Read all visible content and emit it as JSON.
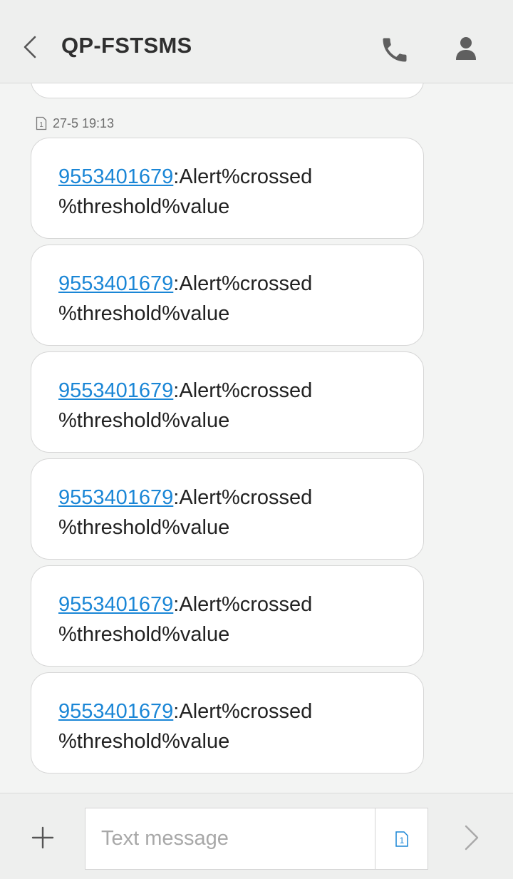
{
  "header": {
    "title": "QP-FSTSMS",
    "back_icon": "chevron-left-icon",
    "call_icon": "phone-icon",
    "contact_icon": "person-icon"
  },
  "thread": {
    "timestamp": "27-5 19:13",
    "sim_badge": "1",
    "messages": [
      {
        "sender_number": "9553401679",
        "line1": ":Alert%crossed",
        "line2": "%threshold%value"
      },
      {
        "sender_number": "9553401679",
        "line1": ":Alert%crossed",
        "line2": "%threshold%value"
      },
      {
        "sender_number": "9553401679",
        "line1": ":Alert%crossed",
        "line2": "%threshold%value"
      },
      {
        "sender_number": "9553401679",
        "line1": ":Alert%crossed",
        "line2": "%threshold%value"
      },
      {
        "sender_number": "9553401679",
        "line1": ":Alert%crossed",
        "line2": "%threshold%value"
      },
      {
        "sender_number": "9553401679",
        "line1": ":Alert%crossed",
        "line2": "%threshold%value"
      }
    ]
  },
  "composer": {
    "placeholder": "Text message",
    "value": "",
    "sim_badge": "1",
    "add_icon": "plus-icon",
    "send_icon": "chevron-right-icon"
  },
  "colors": {
    "link": "#1a86d6",
    "background": "#f3f4f3",
    "header_bg": "#eeefee",
    "bubble_bg": "#ffffff"
  }
}
